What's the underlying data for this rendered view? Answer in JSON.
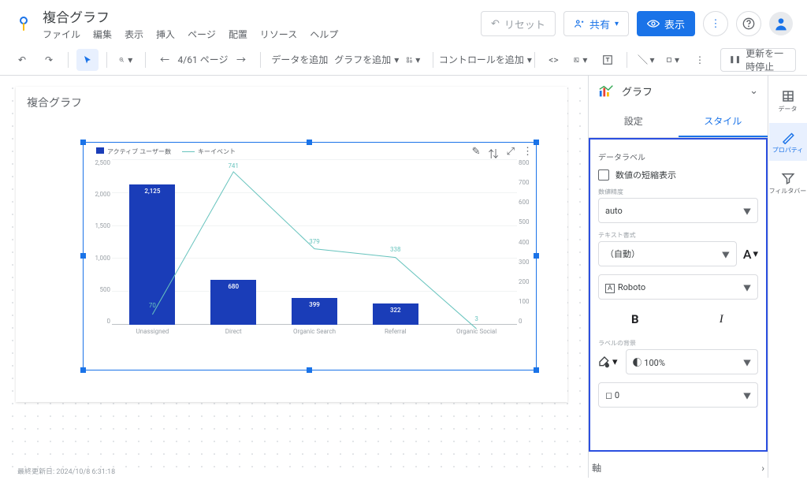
{
  "header": {
    "title": "複合グラフ",
    "menu": [
      "ファイル",
      "編集",
      "表示",
      "挿入",
      "ページ",
      "配置",
      "リソース",
      "ヘルプ"
    ],
    "reset": "リセット",
    "share": "共有",
    "view": "表示"
  },
  "toolbar": {
    "page": "4/61 ページ",
    "add_data": "データを追加",
    "add_chart": "グラフを追加",
    "add_control": "コントロールを追加",
    "pause": "更新を一時停止"
  },
  "canvas": {
    "frame_title": "複合グラフ",
    "timestamp": "最終更新日: 2024/10/8 6:31:18"
  },
  "chart_data": {
    "type": "combo",
    "categories": [
      "Unassigned",
      "Direct",
      "Organic Search",
      "Referral",
      "Organic Social"
    ],
    "series": [
      {
        "name": "アクティブ ユーザー数",
        "kind": "bar",
        "values": [
          2125,
          680,
          399,
          322,
          0
        ]
      },
      {
        "name": "キーイベント",
        "kind": "line",
        "values": [
          70,
          741,
          379,
          338,
          3
        ]
      }
    ],
    "y_left_ticks": [
      "2,500",
      "2,000",
      "1,500",
      "1,000",
      "500",
      "0"
    ],
    "y_right_ticks": [
      "800",
      "700",
      "600",
      "500",
      "400",
      "300",
      "200",
      "100",
      "0"
    ],
    "y_left_max": 2500,
    "y_right_max": 800
  },
  "rpanel": {
    "head": "グラフ",
    "tab_settings": "設定",
    "tab_style": "スタイル",
    "datalabel": "データラベル",
    "compact": "数値の短縮表示",
    "precision_label": "数値精度",
    "precision_value": "auto",
    "textfmt_label": "テキスト書式",
    "textfmt_value": "（自動）",
    "font_label": "A",
    "font_family": "Roboto",
    "bold": "B",
    "italic": "I",
    "label_bg": "ラベルの背景",
    "opacity": "100%",
    "size_value": "0",
    "axis": "軸"
  },
  "rail": {
    "data": "データ",
    "prop": "プロパティ",
    "filter": "フィルタバー"
  }
}
